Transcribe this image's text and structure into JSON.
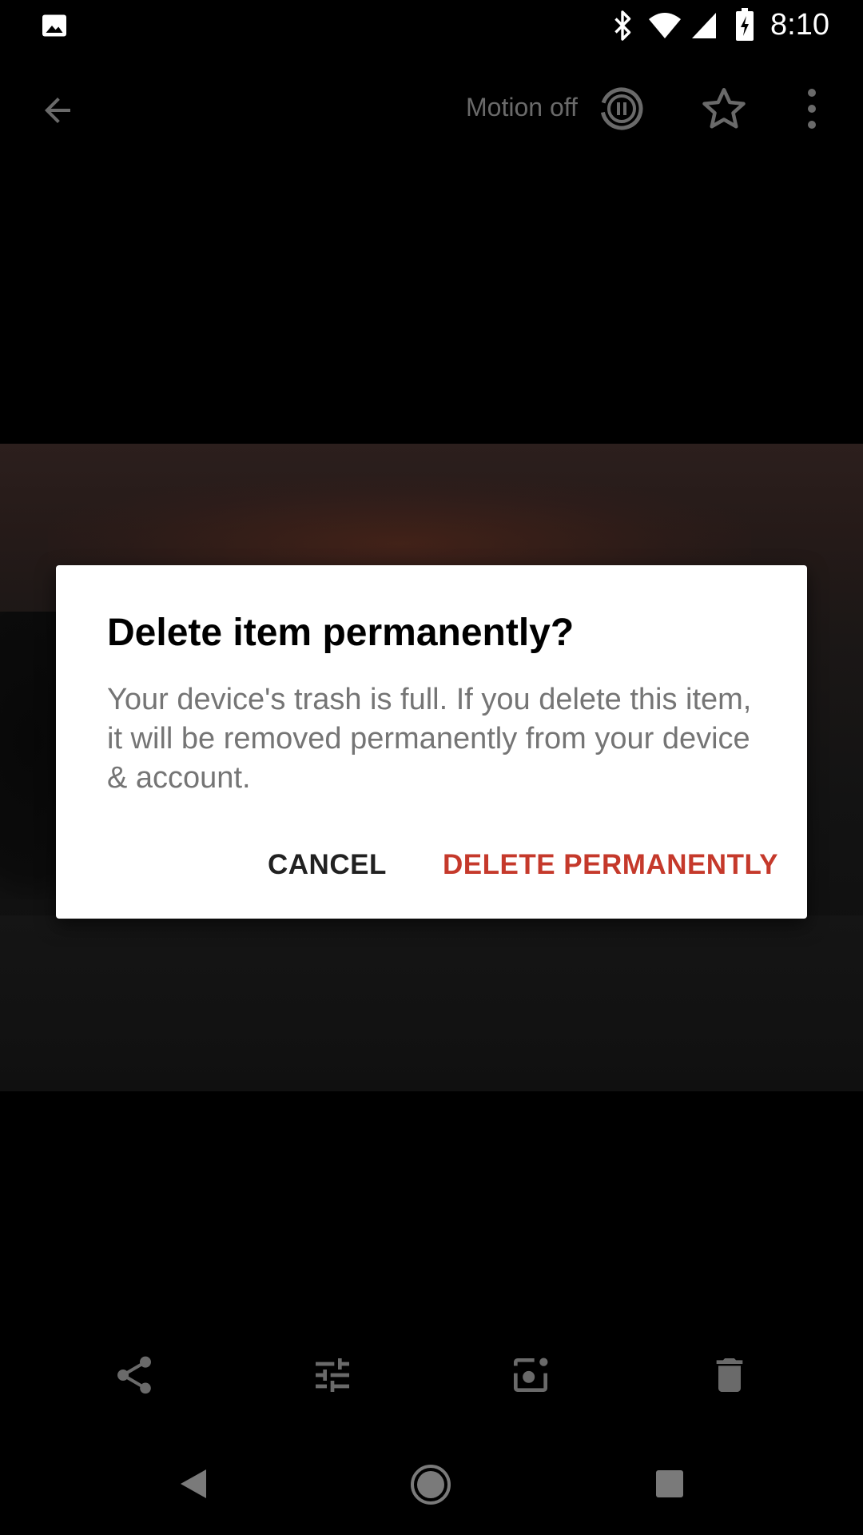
{
  "status_bar": {
    "time": "8:10",
    "icons": [
      "image-notification-icon",
      "bluetooth-icon",
      "wifi-icon",
      "cell-signal-icon",
      "battery-charging-icon"
    ]
  },
  "top_bar": {
    "motion_label": "Motion off",
    "icons": [
      "back-arrow-icon",
      "motion-toggle-icon",
      "star-icon",
      "more-vert-icon"
    ]
  },
  "dialog": {
    "title": "Delete item permanently?",
    "body": "Your device's trash is full. If you delete this item, it will be removed permanently from your device & account.",
    "cancel_label": "CANCEL",
    "delete_label": "DELETE PERMANENTLY"
  },
  "action_bar": {
    "icons": [
      "share-icon",
      "edit-adjust-icon",
      "lens-icon",
      "trash-icon"
    ]
  },
  "nav_bar": {
    "icons": [
      "nav-back-icon",
      "nav-home-icon",
      "nav-recents-icon"
    ]
  },
  "colors": {
    "background": "#000000",
    "dialog_background": "#ffffff",
    "delete_accent": "#c5392b",
    "dim_icon": "#6a6a6a"
  }
}
